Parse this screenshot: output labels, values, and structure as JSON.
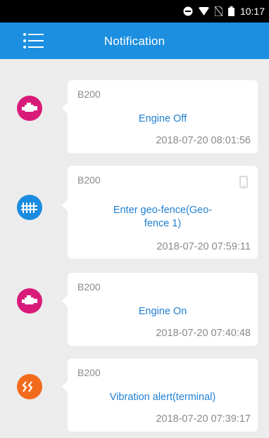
{
  "status_bar": {
    "time": "10:17",
    "icons": [
      "do-not-disturb-icon",
      "wifi-icon",
      "no-sim-icon",
      "battery-icon"
    ]
  },
  "appbar": {
    "title": "Notification",
    "menu_icon": "menu-list-icon"
  },
  "colors": {
    "appbar": "#1c8fe0",
    "engine": "#d81b79",
    "geofence": "#1a8ce0",
    "vibration": "#f26b1d",
    "message": "#1f7fd1"
  },
  "notifications": [
    {
      "unit": "B200",
      "message": "Engine Off",
      "time": "2018-07-20 08:01:56",
      "icon": "engine-icon"
    },
    {
      "unit": "B200",
      "message": "Enter geo-fence(Geo-fence 1)",
      "message_line1": "Enter geo-fence(Geo-",
      "message_line2": "fence 1)",
      "time": "2018-07-20 07:59:11",
      "icon": "fence-icon",
      "corner_icon": "phone-icon"
    },
    {
      "unit": "B200",
      "message": "Engine On",
      "time": "2018-07-20 07:40:48",
      "icon": "engine-icon"
    },
    {
      "unit": "B200",
      "message": "Vibration alert(terminal)",
      "time": "2018-07-20 07:39:17",
      "icon": "vibration-icon"
    }
  ]
}
